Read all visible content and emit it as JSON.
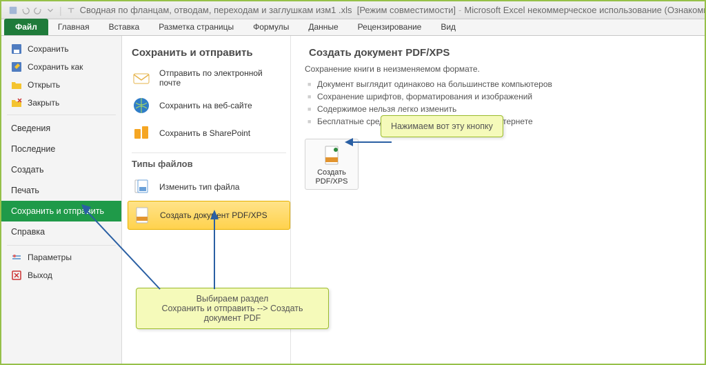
{
  "titlebar": {
    "filename": "Сводная по фланцам, отводам, переходам и заглушкам изм1 .xls",
    "mode": "[Режим совместимости]",
    "app": "Microsoft Excel некоммерческое использование (Ознакомите..."
  },
  "ribbon_tabs": {
    "file": "Файл",
    "home": "Главная",
    "insert": "Вставка",
    "layout": "Разметка страницы",
    "formulas": "Формулы",
    "data": "Данные",
    "review": "Рецензирование",
    "view": "Вид"
  },
  "leftnav": {
    "save": "Сохранить",
    "save_as": "Сохранить как",
    "open": "Открыть",
    "close": "Закрыть",
    "info": "Сведения",
    "recent": "Последние",
    "new": "Создать",
    "print": "Печать",
    "save_send": "Сохранить и отправить",
    "help": "Справка",
    "options": "Параметры",
    "exit": "Выход"
  },
  "midcol": {
    "heading": "Сохранить и отправить",
    "email": "Отправить по электронной почте",
    "web": "Сохранить на веб-сайте",
    "sharepoint": "Сохранить в SharePoint",
    "filetypes_heading": "Типы файлов",
    "change_type": "Изменить тип файла",
    "create_pdf": "Создать документ PDF/XPS"
  },
  "rightcol": {
    "heading": "Создать документ PDF/XPS",
    "desc": "Сохранение книги в неизменяемом формате.",
    "b1": "Документ выглядит одинаково на большинстве компьютеров",
    "b2": "Сохранение шрифтов, форматирования и изображений",
    "b3": "Содержимое нельзя легко изменить",
    "b4": "Бесплатные средства просмотра доступны в Интернете",
    "btn_line1": "Создать",
    "btn_line2": "PDF/XPS"
  },
  "callouts": {
    "top": "Нажимаем вот эту кнопку",
    "bottom_l1": "Выбираем раздел",
    "bottom_l2": "Сохранить и отправить --> Создать документ PDF"
  }
}
